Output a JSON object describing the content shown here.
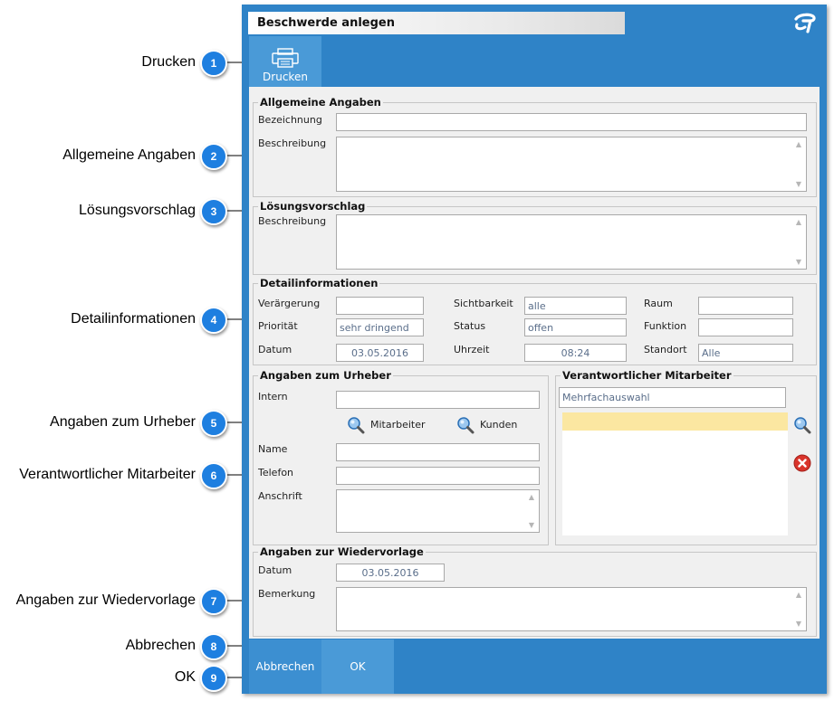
{
  "window": {
    "title": "Beschwerde anlegen"
  },
  "toolbar": {
    "print_label": "Drucken"
  },
  "callouts": [
    {
      "num": "1",
      "label": "Drucken"
    },
    {
      "num": "2",
      "label": "Allgemeine Angaben"
    },
    {
      "num": "3",
      "label": "Lösungsvorschlag"
    },
    {
      "num": "4",
      "label": "Detailinformationen"
    },
    {
      "num": "5",
      "label": "Angaben zum Urheber"
    },
    {
      "num": "6",
      "label": "Verantwortlicher Mitarbeiter"
    },
    {
      "num": "7",
      "label": "Angaben zur Wiedervorlage"
    },
    {
      "num": "8",
      "label": "Abbrechen"
    },
    {
      "num": "9",
      "label": "OK"
    }
  ],
  "general": {
    "legend": "Allgemeine Angaben",
    "bezeichnung_label": "Bezeichnung",
    "bezeichnung_value": "",
    "beschreibung_label": "Beschreibung",
    "beschreibung_value": ""
  },
  "solution": {
    "legend": "Lösungsvorschlag",
    "beschreibung_label": "Beschreibung",
    "beschreibung_value": ""
  },
  "details": {
    "legend": "Detailinformationen",
    "verargerung_label": "Verärgerung",
    "verargerung_value": "",
    "prioritat_label": "Priorität",
    "prioritat_value": "sehr dringend",
    "datum_label": "Datum",
    "datum_value": "03.05.2016",
    "sichtbarkeit_label": "Sichtbarkeit",
    "sichtbarkeit_value": "alle",
    "status_label": "Status",
    "status_value": "offen",
    "uhrzeit_label": "Uhrzeit",
    "uhrzeit_value": "08:24",
    "raum_label": "Raum",
    "raum_value": "",
    "funktion_label": "Funktion",
    "funktion_value": "",
    "standort_label": "Standort",
    "standort_value": "Alle"
  },
  "originator": {
    "legend": "Angaben zum Urheber",
    "intern_label": "Intern",
    "intern_value": "",
    "mitarbeiter_label": "Mitarbeiter",
    "kunden_label": "Kunden",
    "name_label": "Name",
    "name_value": "",
    "telefon_label": "Telefon",
    "telefon_value": "",
    "anschrift_label": "Anschrift",
    "anschrift_value": ""
  },
  "responsible": {
    "legend": "Verantwortlicher Mitarbeiter",
    "mode_value": "Mehrfachauswahl"
  },
  "resubmission": {
    "legend": "Angaben zur Wiedervorlage",
    "datum_label": "Datum",
    "datum_value": "03.05.2016",
    "bemerkung_label": "Bemerkung",
    "bemerkung_value": ""
  },
  "footer": {
    "cancel_label": "Abbrechen",
    "ok_label": "OK"
  },
  "colors": {
    "window_blue": "#2f83c7",
    "button_blue": "#4a9ad7",
    "badge_blue": "#1e7fe0",
    "selection_yellow": "#fbe7a1",
    "delete_red": "#d9342b"
  },
  "icons": [
    "printer-icon",
    "search-icon",
    "delete-icon",
    "app-logo-icon"
  ]
}
